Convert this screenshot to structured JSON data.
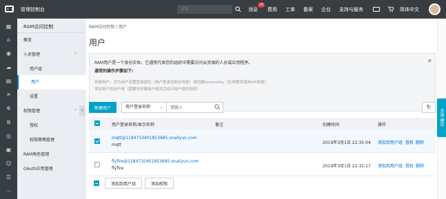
{
  "topbar": {
    "console_title": "管理控制台",
    "search_placeholder": "搜索",
    "messages_label": "消息",
    "messages_badge": "25",
    "fees_label": "费用",
    "tickets_label": "工单",
    "filing_label": "备案",
    "enterprise_label": "企业",
    "support_label": "支持与服务",
    "language_label": "简体中文"
  },
  "nav": {
    "title": "RAM访问控制",
    "items": [
      {
        "label": "概览"
      },
      {
        "label": "人员管理"
      },
      {
        "label": "用户组"
      },
      {
        "label": "用户"
      },
      {
        "label": "设置"
      },
      {
        "label": "权限管理"
      },
      {
        "label": "授权"
      },
      {
        "label": "权限策略管理"
      },
      {
        "label": "RAM角色管理"
      },
      {
        "label": "OAuth应用管理"
      }
    ]
  },
  "main": {
    "breadcrumb": "RAM访问控制 / 用户",
    "title": "用户",
    "info": {
      "line1": "RAM用户是一个身份实体，它通常代表您的组织中需要访问云资源的人员或应用程序。",
      "line2": "通常的操作步骤如下:",
      "line3": "创建用户，并为用户设置登录密码（用户登录控制台场景）或创建AccessKey（应用程序调用API场景）",
      "line4": "添加用户到用户组（需要先创建用户组并完成对用户组的授权）"
    },
    "new_user_label": "新建用户",
    "filter_select": "用户登录名称",
    "filter_placeholder": "请输入",
    "columns": {
      "name": "用户登录名称/显示名称",
      "remark": "备注",
      "created": "创建时间",
      "actions": "操作"
    },
    "rows": [
      {
        "login": "mqtt@1184710401853685.onaliyun.com",
        "display": "mqtt",
        "created": "2019年3月1日 22:35:04",
        "checked": true
      },
      {
        "login": "flyfire@1184710401853685.onaliyun.com",
        "display": "flyfire",
        "created": "2019年3月1日 22:32:17",
        "checked": false
      }
    ],
    "row_actions": {
      "add_to_group": "添加到用户组",
      "grant": "授权",
      "delete": "删除"
    },
    "bottom": {
      "add_to_group": "添加到用户组",
      "add_permission": "添加权限"
    }
  },
  "feedback_label": "咨询·建议",
  "colors": {
    "accent": "#00a2ca",
    "link": "#0070cc",
    "topbar": "#373d41"
  }
}
